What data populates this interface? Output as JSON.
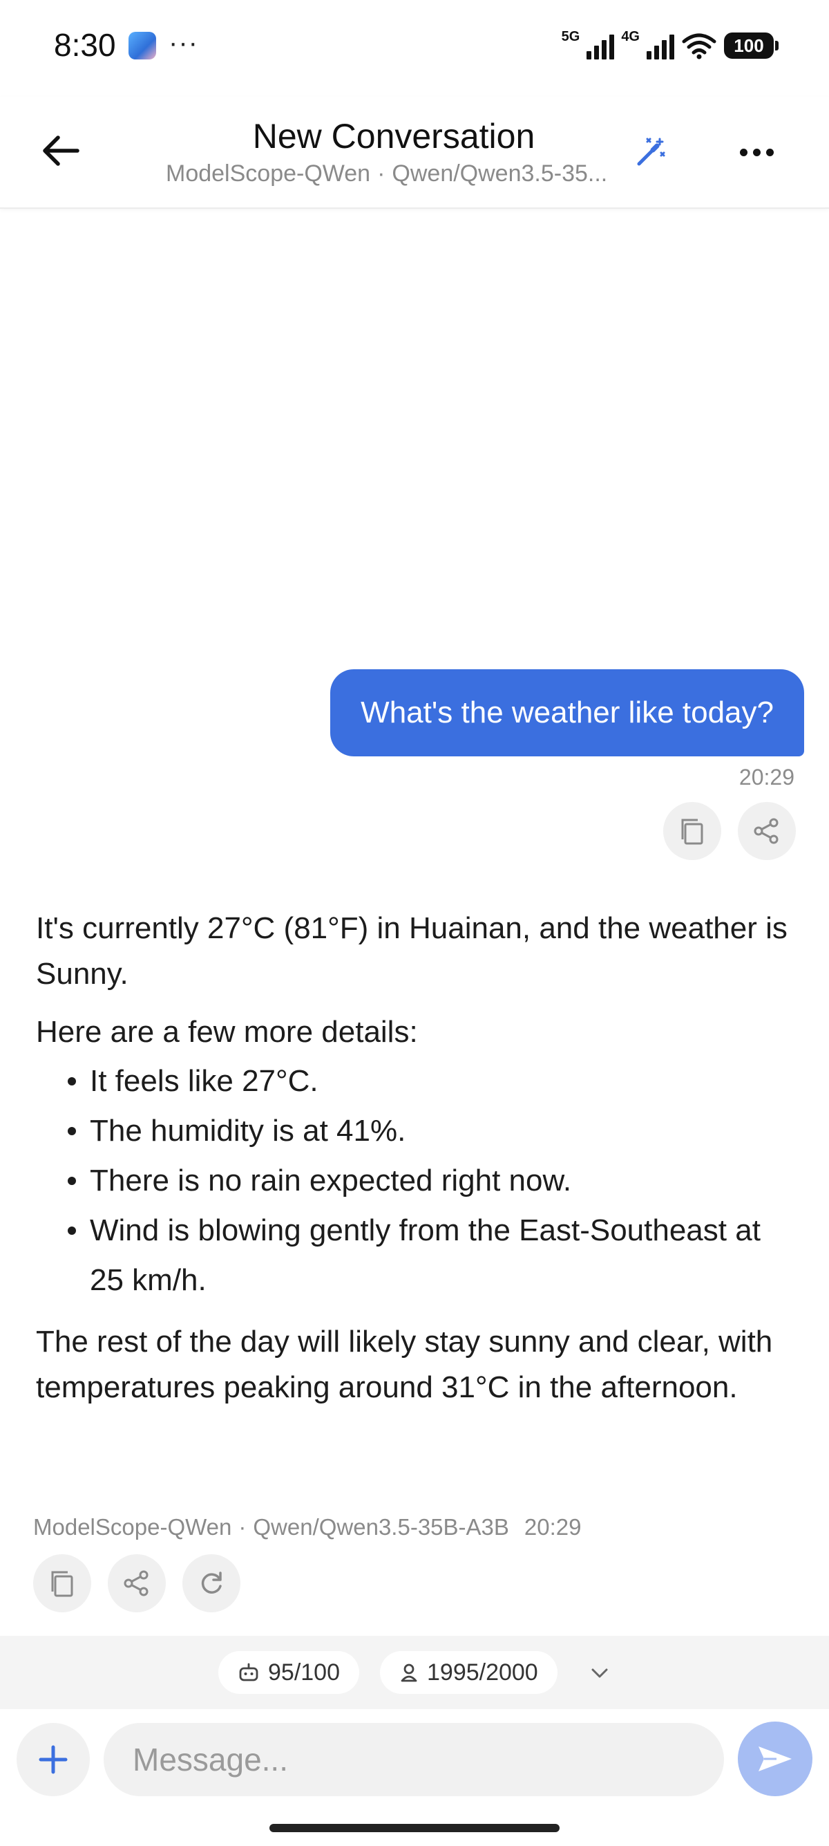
{
  "status_bar": {
    "time": "8:30",
    "more": "···",
    "sig1_label": "5G",
    "sig2_label": "4G",
    "battery": "100"
  },
  "header": {
    "title": "New Conversation",
    "provider": "ModelScope-QWen",
    "separator": "·",
    "model": "Qwen/Qwen3.5-35..."
  },
  "user_message": {
    "text": "What's the weather like today?",
    "time": "20:29"
  },
  "assistant_message": {
    "p1_a": "It's currently ",
    "p1_temp": "27°C (81°F)",
    "p1_b": " in Huainan, and the weather is ",
    "p1_cond": "Sunny",
    "p1_c": ".",
    "p2": "Here are a few more details:",
    "bullets": [
      "It feels like 27°C.",
      "The humidity is at 41%.",
      "There is no rain expected right now.",
      "Wind is blowing gently from the East-Southeast at 25 km/h."
    ],
    "p3": "The rest of the day will likely stay sunny and clear, with temperatures peaking around 31°C in the afternoon.",
    "meta_provider": "ModelScope-QWen",
    "meta_separator": "·",
    "meta_model": "Qwen/Qwen3.5-35B-A3B",
    "meta_time": "20:29"
  },
  "tokens": {
    "assistant_count": "95/100",
    "user_count": "1995/2000"
  },
  "composer": {
    "placeholder": "Message..."
  },
  "colors": {
    "accent": "#3b6fdf",
    "send_disabled": "#a6bdf3"
  }
}
